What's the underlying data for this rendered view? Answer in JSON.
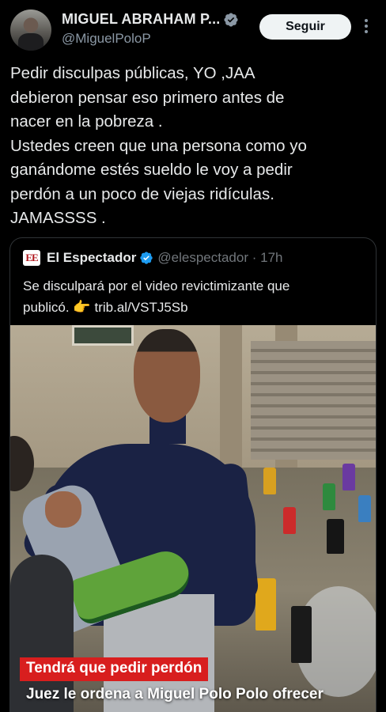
{
  "author": {
    "display_name": "MIGUEL ABRAHAM P...",
    "handle": "@MiguelPoloP",
    "verified": true,
    "follow_label": "Seguir"
  },
  "tweet": {
    "text": "Pedir disculpas públicas, YO ,JAA\ndebieron pensar eso primero antes de\nnacer en la pobreza .\nUstedes creen que una persona como yo\nganándome estés sueldo le voy a pedir\nperdón a un poco de viejas ridículas.\nJAMASSSS ."
  },
  "quoted": {
    "logo_text": "EE",
    "name": "El Espectador",
    "handle": "@elespectador",
    "separator": "·",
    "time": "17h",
    "text_line1": "Se disculpará por el video revictimizante que",
    "text_line2": "publicó.",
    "pointer_emoji": "👉",
    "link": "trib.al/VSTJ5Sb",
    "media": {
      "caption_headline": "Tendrá que pedir perdón",
      "caption_subline": "Juez le ordena a Miguel Polo Polo ofrecer"
    }
  },
  "colors": {
    "background": "#000000",
    "text": "#e7e9ea",
    "muted": "#71767b",
    "verified_blue": "#1d9bf0",
    "caption_red": "#d81e1e"
  }
}
